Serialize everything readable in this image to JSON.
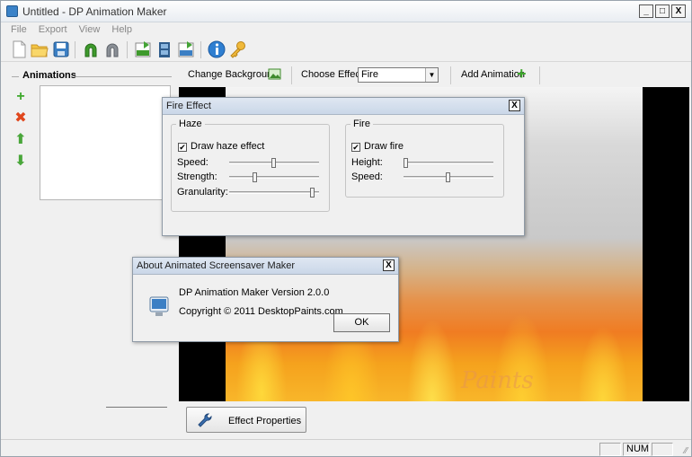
{
  "window": {
    "title": "Untitled - DP Animation Maker",
    "minimize": "_",
    "maximize": "□",
    "close": "X"
  },
  "menu": [
    "File",
    "Export",
    "View",
    "Help"
  ],
  "toolbar": {
    "icons": [
      "new-file-icon",
      "open-folder-icon",
      "save-icon",
      "magnet-icon",
      "magnet-icon",
      "export-gif-icon",
      "export-video-icon",
      "export-exe-icon",
      "info-icon",
      "key-icon"
    ]
  },
  "left_panel": {
    "heading": "Animations",
    "actions": [
      {
        "name": "add-icon",
        "glyph": "+",
        "color": "#3ea82c"
      },
      {
        "name": "delete-icon",
        "glyph": "✖",
        "color": "#e0461c"
      },
      {
        "name": "move-up-icon",
        "glyph": "⬆",
        "color": "#49a63a"
      },
      {
        "name": "move-down-icon",
        "glyph": "⬇",
        "color": "#49a63a"
      }
    ]
  },
  "controls": {
    "change_background": "Change Background",
    "choose_effect_label": "Choose Effect:",
    "effect_value": "Fire",
    "add_animation": "Add Animation"
  },
  "preview": {
    "watermark": "Paints"
  },
  "effect_properties_button": "Effect Properties",
  "status": {
    "num": "NUM"
  },
  "fire_effect_dialog": {
    "title": "Fire Effect",
    "close": "X",
    "haze": {
      "title": "Haze",
      "checkbox_label": "Draw haze effect",
      "checked": true,
      "sliders": [
        {
          "label": "Speed:",
          "value": 0.5
        },
        {
          "label": "Strength:",
          "value": 0.28
        },
        {
          "label": "Granularity:",
          "value": 0.97
        }
      ]
    },
    "fire": {
      "title": "Fire",
      "checkbox_label": "Draw fire",
      "checked": true,
      "sliders": [
        {
          "label": "Height:",
          "value": 0.0
        },
        {
          "label": "Speed:",
          "value": 0.5
        }
      ]
    }
  },
  "about_dialog": {
    "title": "About Animated Screensaver Maker",
    "close": "X",
    "version": "DP Animation Maker Version 2.0.0",
    "copyright": "Copyright © 2011 DesktopPaints.com",
    "ok": "OK"
  },
  "colors": {
    "accent": "#3a82c8",
    "fire": "#f07c22"
  }
}
